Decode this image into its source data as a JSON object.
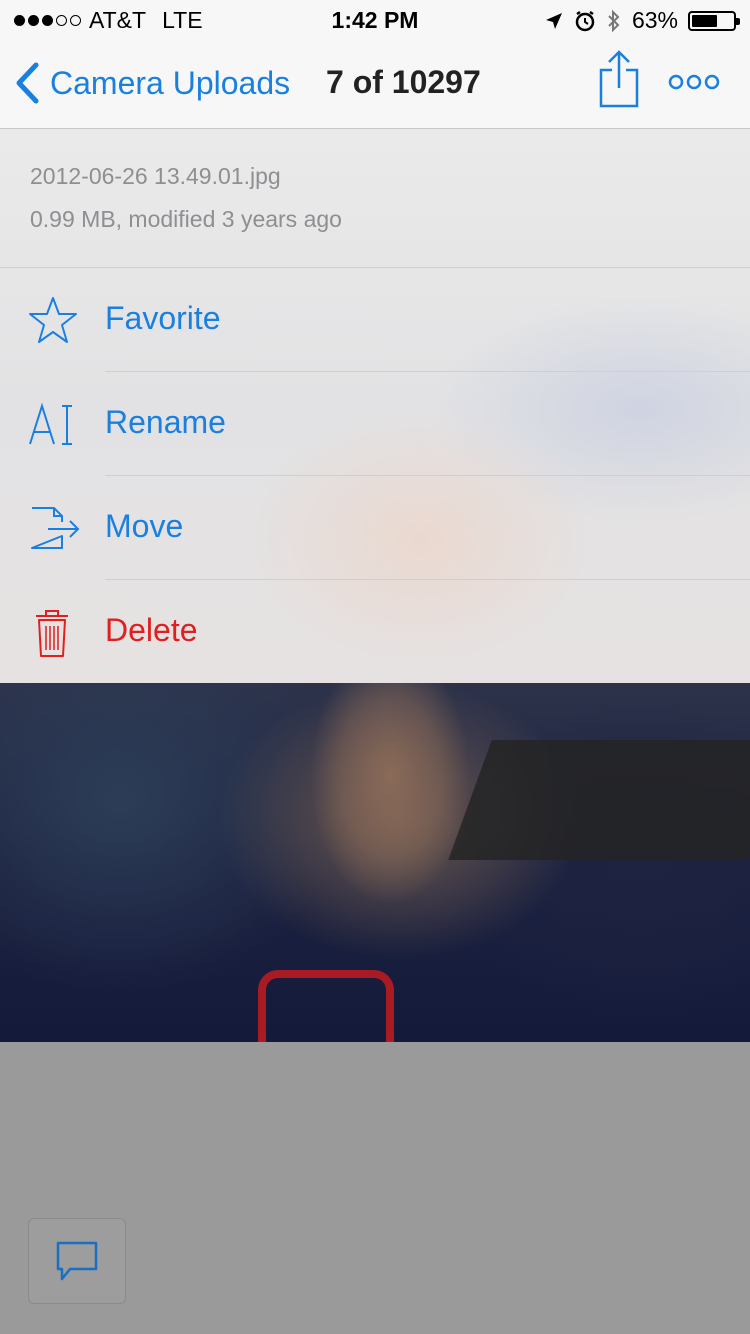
{
  "status_bar": {
    "carrier": "AT&T",
    "network": "LTE",
    "time": "1:42 PM",
    "battery_percent": "63%",
    "battery_level": 0.63,
    "signal_bars": 3,
    "icons": [
      "location-arrow-icon",
      "alarm-icon",
      "bluetooth-icon",
      "battery-icon"
    ]
  },
  "nav": {
    "back_label": "Camera Uploads",
    "title": "7 of 10297",
    "share_icon": "share-icon",
    "more_icon": "more-icon"
  },
  "file": {
    "name": "2012-06-26 13.49.01.jpg",
    "meta": "0.99 MB, modified 3 years ago"
  },
  "menu": {
    "items": [
      {
        "label": "Favorite",
        "icon": "star-icon"
      },
      {
        "label": "Rename",
        "icon": "rename-icon"
      },
      {
        "label": "Move",
        "icon": "move-icon"
      },
      {
        "label": "Delete",
        "icon": "trash-icon"
      }
    ]
  },
  "colors": {
    "accent": "#1a80e0",
    "danger": "#e02020"
  },
  "bottom": {
    "comment_icon": "comment-icon"
  }
}
